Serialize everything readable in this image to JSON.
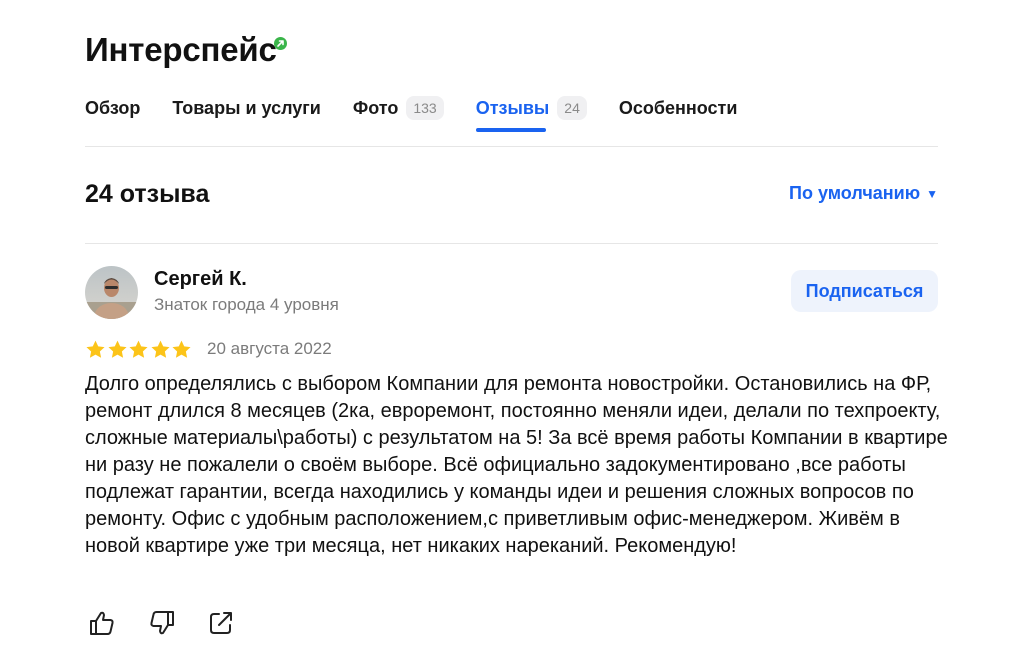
{
  "header": {
    "title": "Интерспейс",
    "verified_color": "#3ab54a"
  },
  "tabs": [
    {
      "label": "Обзор",
      "count": null,
      "active": false
    },
    {
      "label": "Товары и услуги",
      "count": null,
      "active": false
    },
    {
      "label": "Фото",
      "count": "133",
      "active": false
    },
    {
      "label": "Отзывы",
      "count": "24",
      "active": true
    },
    {
      "label": "Особенности",
      "count": null,
      "active": false
    }
  ],
  "reviews_header": {
    "count_label": "24 отзыва",
    "sort_label": "По умолчанию"
  },
  "review": {
    "author_name": "Сергей К.",
    "author_level": "Знаток города 4 уровня",
    "subscribe_label": "Подписаться",
    "rating": 5,
    "rating_max": 5,
    "date": "20 августа 2022",
    "text": "Долго определялись с выбором Компании для ремонта новостройки. Остановились на ФР, ремонт длился 8 месяцев (2ка, евроремонт, постоянно меняли идеи, делали по техпроекту, сложные материалы\\работы) с результатом на 5! За всё время работы Компании в квартире ни разу не пожалели о своём выборе. Всё официально задокументировано ,все работы подлежат гарантии, всегда находились у команды идеи и решения сложных вопросов по ремонту. Офис с удобным расположением,с приветливым офис-менеджером. Живём в новой квартире уже три месяца, нет никаких нареканий. Рекомендую!",
    "actions": [
      "thumbs-up-icon",
      "thumbs-down-icon",
      "share-icon"
    ]
  },
  "colors": {
    "accent": "#1a63f0",
    "star": "#fcc419",
    "muted_text": "#7b7b7b"
  }
}
